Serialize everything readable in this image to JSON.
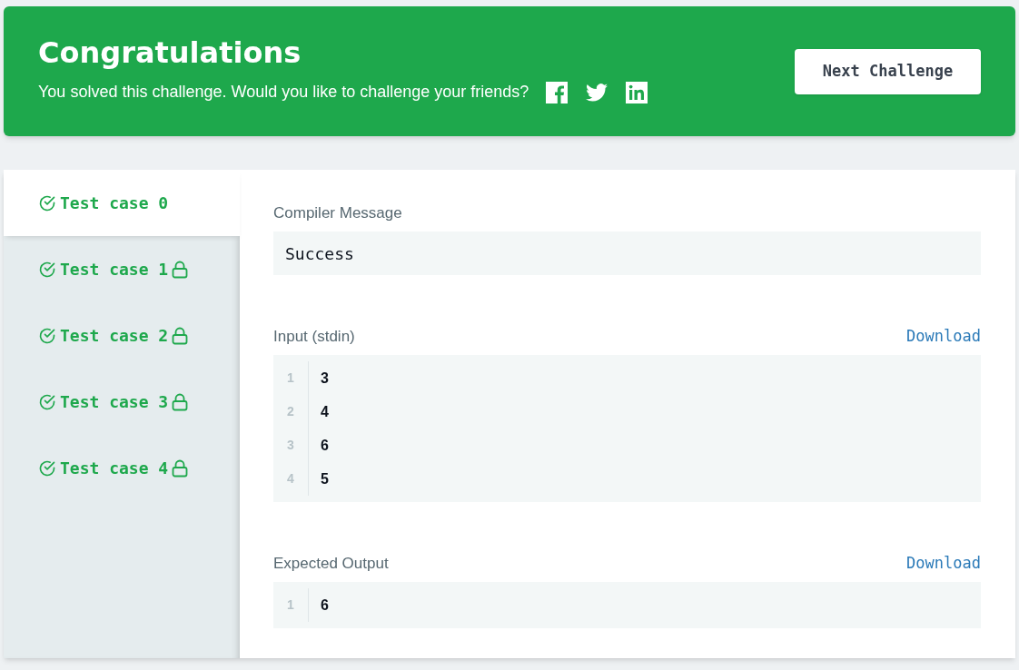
{
  "banner": {
    "title": "Congratulations",
    "message": "You solved this challenge. Would you like to challenge your friends?",
    "share": [
      {
        "kind": "facebook"
      },
      {
        "kind": "twitter"
      },
      {
        "kind": "linkedin"
      }
    ],
    "button": "Next Challenge"
  },
  "test_cases": [
    {
      "label": "Test case 0",
      "selected": true,
      "passed": true,
      "locked": false
    },
    {
      "label": "Test case 1",
      "selected": false,
      "passed": true,
      "locked": true
    },
    {
      "label": "Test case 2",
      "selected": false,
      "passed": true,
      "locked": true
    },
    {
      "label": "Test case 3",
      "selected": false,
      "passed": true,
      "locked": true
    },
    {
      "label": "Test case 4",
      "selected": false,
      "passed": true,
      "locked": true
    }
  ],
  "sections": [
    {
      "kind": "message",
      "label": "Compiler Message",
      "text": "Success"
    },
    {
      "kind": "code",
      "label": "Input (stdin)",
      "download": "Download",
      "lines": [
        {
          "number": "1",
          "text": "3"
        },
        {
          "number": "2",
          "text": "4"
        },
        {
          "number": "3",
          "text": "6"
        },
        {
          "number": "4",
          "text": "5"
        }
      ]
    },
    {
      "kind": "code",
      "label": "Expected Output",
      "download": "Download",
      "lines": [
        {
          "number": "1",
          "text": "6"
        }
      ]
    }
  ]
}
